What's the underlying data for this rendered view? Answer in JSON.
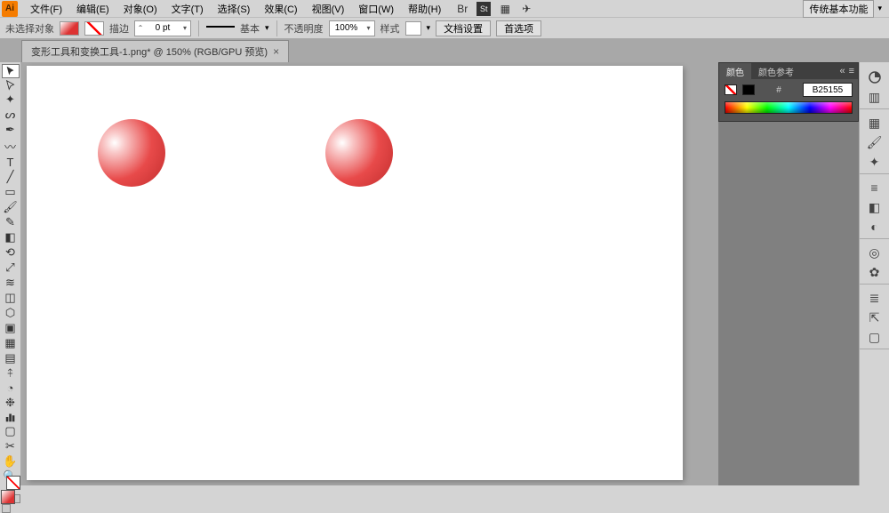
{
  "menubar": {
    "items": [
      "文件(F)",
      "编辑(E)",
      "对象(O)",
      "文字(T)",
      "选择(S)",
      "效果(C)",
      "视图(V)",
      "窗口(W)",
      "帮助(H)"
    ],
    "workspace": "传统基本功能"
  },
  "controlbar": {
    "no_selection": "未选择对象",
    "stroke_label": "描边",
    "stroke_value": "0 pt",
    "basic_label": "基本",
    "opacity_label": "不透明度",
    "opacity_value": "100%",
    "style_label": "样式",
    "docsetup": "文档设置",
    "prefs": "首选项"
  },
  "tab": {
    "title": "变形工具和变换工具-1.png* @ 150% (RGB/GPU 预览)"
  },
  "tools": {
    "names": [
      "selection",
      "direct-selection",
      "magic-wand",
      "lasso",
      "pen",
      "curvature",
      "type",
      "line",
      "rectangle",
      "paintbrush",
      "pencil",
      "eraser",
      "rotate",
      "scale",
      "width",
      "free-transform",
      "shape-builder",
      "perspective",
      "mesh",
      "gradient",
      "eyedropper",
      "blend",
      "symbol-sprayer",
      "column-graph",
      "artboard",
      "slice",
      "hand",
      "zoom"
    ]
  },
  "panel": {
    "tab1": "颜色",
    "tab2": "颜色参考",
    "hex": "B25155"
  },
  "dock": {
    "groups": [
      [
        "color-icon",
        "color-guide-icon"
      ],
      [
        "swatches-icon",
        "brushes-icon",
        "symbols-icon"
      ],
      [
        "stroke-icon",
        "gradient-panel-icon",
        "transparency-icon"
      ],
      [
        "appearance-icon",
        "graphic-styles-icon"
      ],
      [
        "layers-icon",
        "asset-export-icon",
        "artboards-icon"
      ]
    ]
  }
}
